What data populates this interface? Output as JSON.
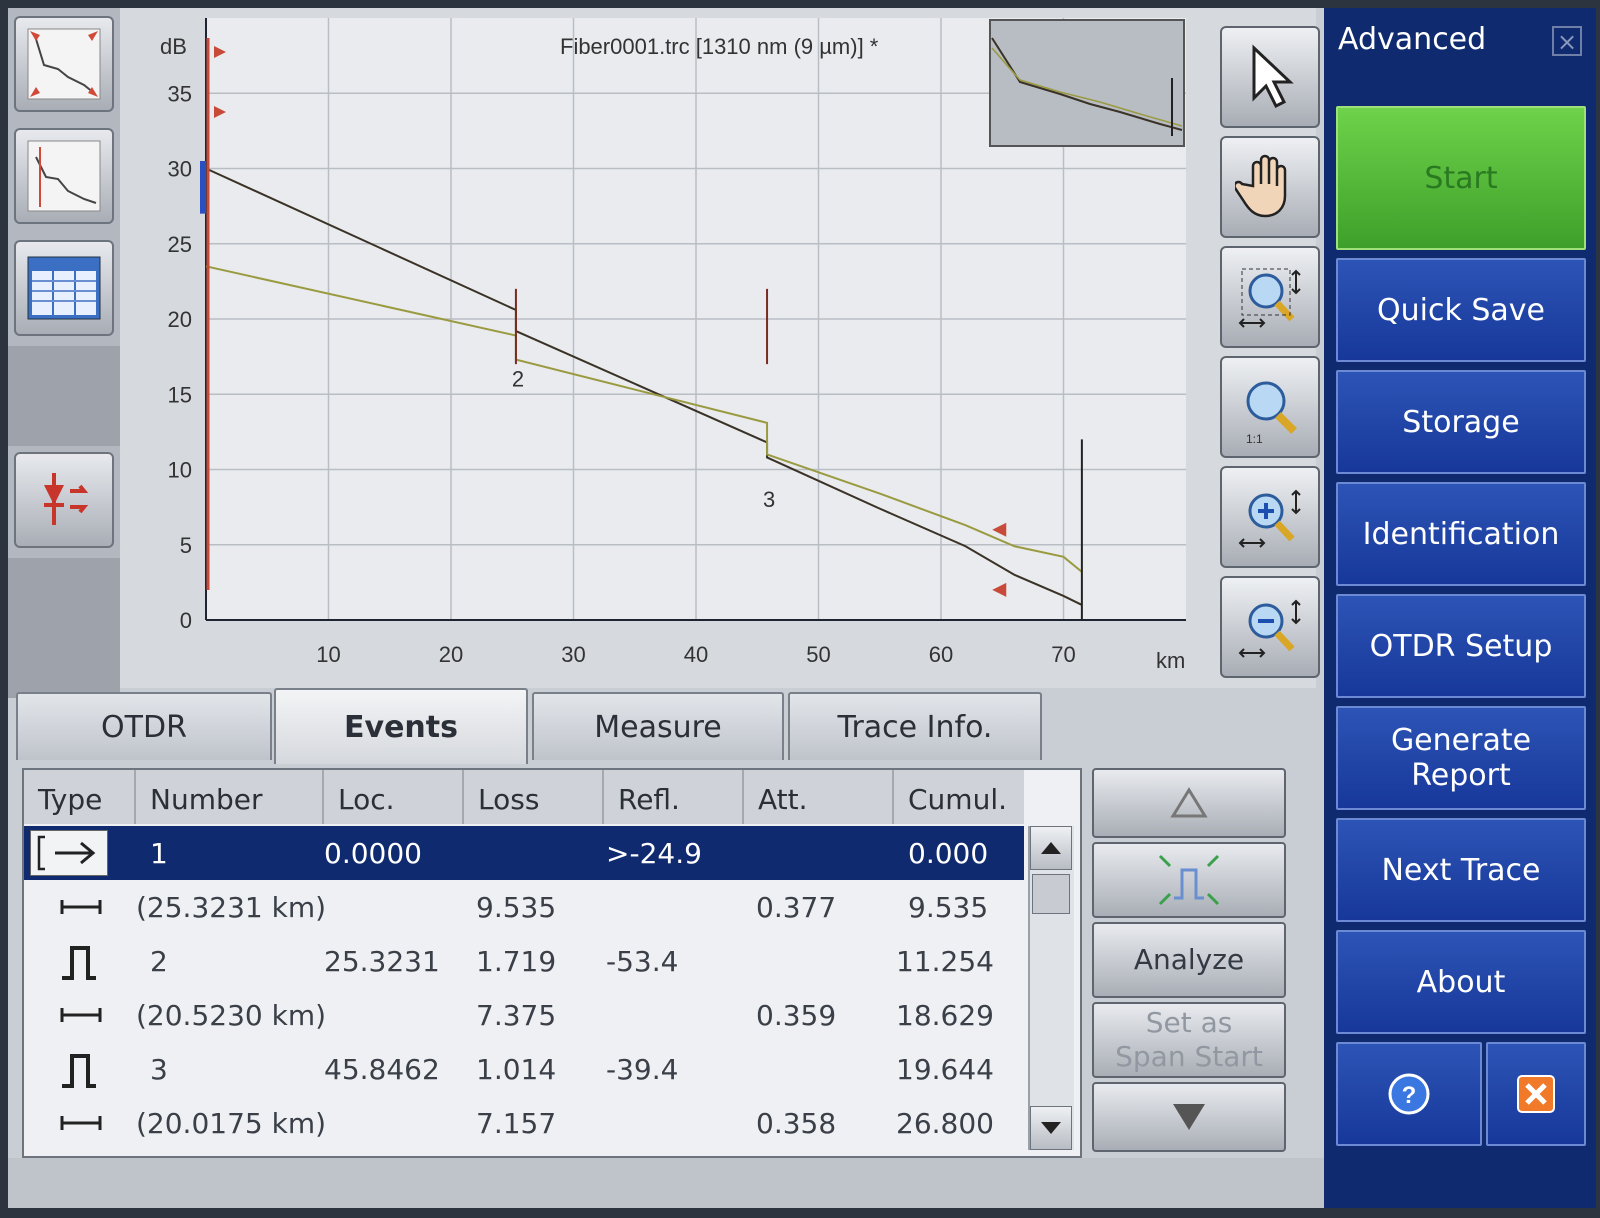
{
  "sidebar": {
    "title": "Advanced",
    "buttons": [
      "Start",
      "Quick Save",
      "Storage",
      "Identification",
      "OTDR Setup",
      "Generate Report",
      "Next Trace",
      "About"
    ],
    "bottom_icons": [
      "help-icon",
      "exit-icon"
    ]
  },
  "left_toolbar": {
    "icons": [
      "trace-overview-icon",
      "trace-zoom-icon",
      "event-table-icon",
      "laser-source-icon"
    ]
  },
  "right_toolbar": {
    "icons": [
      "pointer-icon",
      "pan-hand-icon",
      "zoom-area-icon",
      "zoom-full-icon",
      "zoom-in-icon",
      "zoom-out-icon"
    ]
  },
  "tabs": [
    {
      "label": "OTDR",
      "active": false
    },
    {
      "label": "Events",
      "active": true
    },
    {
      "label": "Measure",
      "active": false
    },
    {
      "label": "Trace Info.",
      "active": false
    }
  ],
  "table": {
    "headers": [
      "Type",
      "Number",
      "Loc.",
      "Loss",
      "Refl.",
      "Att.",
      "Cumul."
    ],
    "rows": [
      {
        "type": "launch",
        "number": "1",
        "loc": "0.0000",
        "loss": "",
        "refl": ">-24.9",
        "att": "",
        "cumul": "0.000",
        "selected": true
      },
      {
        "type": "span",
        "number": "(25.3231 km)",
        "loc": "",
        "loss": "9.535",
        "refl": "",
        "att": "0.377",
        "cumul": "9.535"
      },
      {
        "type": "reflective",
        "number": "2",
        "loc": "25.3231",
        "loss": "1.719",
        "refl": "-53.4",
        "att": "",
        "cumul": "11.254"
      },
      {
        "type": "span",
        "number": "(20.5230 km)",
        "loc": "",
        "loss": "7.375",
        "refl": "",
        "att": "0.359",
        "cumul": "18.629"
      },
      {
        "type": "reflective",
        "number": "3",
        "loc": "45.8462",
        "loss": "1.014",
        "refl": "-39.4",
        "att": "",
        "cumul": "19.644"
      },
      {
        "type": "span",
        "number": "(20.0175 km)",
        "loc": "",
        "loss": "7.157",
        "refl": "",
        "att": "0.358",
        "cumul": "26.800"
      }
    ]
  },
  "table_buttons": {
    "analyze": "Analyze",
    "set_span_line1": "Set as",
    "set_span_line2": "Span Start"
  },
  "chart_data": {
    "type": "line",
    "title": "Fiber0001.trc [1310 nm (9 µm)] *",
    "ylabel": "dB",
    "xlabel": "km",
    "xlim": [
      0,
      80
    ],
    "ylim": [
      0,
      40
    ],
    "xticks": [
      10,
      20,
      30,
      40,
      50,
      60,
      70
    ],
    "yticks": [
      0,
      5,
      10,
      15,
      20,
      25,
      30,
      35
    ],
    "grid": true,
    "event_labels": [
      {
        "label": "2",
        "x": 25.3
      },
      {
        "label": "3",
        "x": 45.8
      }
    ],
    "series": [
      {
        "color": "#3a3226",
        "points": [
          [
            0,
            30.0
          ],
          [
            25.3,
            20.6
          ],
          [
            25.3,
            19.2
          ],
          [
            45.8,
            11.8
          ],
          [
            45.8,
            10.8
          ],
          [
            55,
            7.4
          ],
          [
            62,
            4.9
          ],
          [
            66,
            3.0
          ],
          [
            70,
            1.6
          ],
          [
            71.5,
            1.0
          ]
        ]
      },
      {
        "color": "#9a9a40",
        "points": [
          [
            0,
            23.5
          ],
          [
            25.3,
            18.9
          ],
          [
            25.3,
            17.3
          ],
          [
            45.8,
            13.1
          ],
          [
            45.8,
            11.0
          ],
          [
            55,
            8.4
          ],
          [
            62,
            6.3
          ],
          [
            66,
            4.9
          ],
          [
            70,
            4.2
          ],
          [
            71.5,
            3.2
          ]
        ]
      }
    ],
    "colors": {
      "grid": "#b9bdc4",
      "marker": "#c84b3a",
      "axis": "#1f2530"
    }
  }
}
